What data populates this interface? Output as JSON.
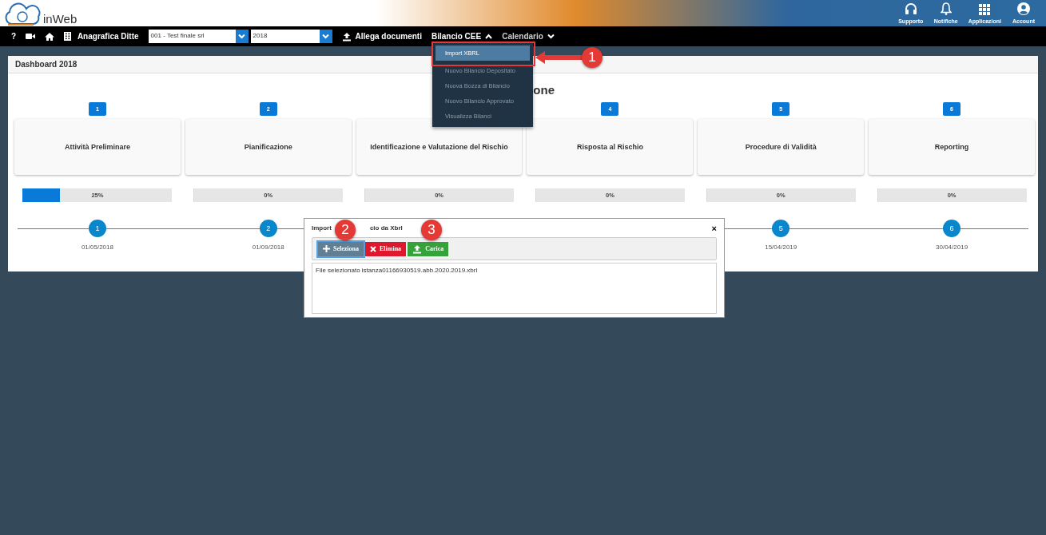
{
  "header": {
    "logo_text": "inWeb",
    "actions": [
      {
        "kind": "headset",
        "label": "Supporto"
      },
      {
        "kind": "bell",
        "label": "Notifiche"
      },
      {
        "kind": "grid",
        "label": "Applicazioni"
      },
      {
        "kind": "user",
        "label": "Account"
      }
    ]
  },
  "navbar": {
    "help": "?",
    "company_label": "Anagrafica Ditte",
    "company_select": "001 - Test finale srl",
    "year_select": "2018",
    "attach": "Allega documenti",
    "menus": [
      {
        "label": "Bilancio CEE",
        "expanded": true
      },
      {
        "label": "Calendario",
        "expanded": false
      }
    ]
  },
  "dropdown": {
    "items": [
      {
        "label": "Import XBRL",
        "selected": true
      },
      {
        "label": "Nuovo Bilancio Depositato",
        "selected": false
      },
      {
        "label": "Nuova Bozza di Bilancio",
        "selected": false
      },
      {
        "label": "Nuovo Bilancio Approvato",
        "selected": false
      },
      {
        "label": "Visualizza Bilanci",
        "selected": false
      }
    ]
  },
  "panel": {
    "title": "Dashboard 2018",
    "heading_fragment": "one",
    "stages": [
      {
        "badge": "1",
        "name": "Attività Preliminare",
        "level": 0.25,
        "percent": "25%",
        "milestone": {
          "number": "1",
          "date": "01/05/2018"
        }
      },
      {
        "badge": "2",
        "name": "Pianificazione",
        "level": 0,
        "percent": "0%",
        "milestone": {
          "number": "2",
          "date": "01/09/2018"
        }
      },
      {
        "name": "Identificazione e Valutazione del Rischio",
        "level": 0,
        "percent": "0%"
      },
      {
        "badge": "4",
        "name": "Risposta al Rischio",
        "level": 0,
        "percent": "0%"
      },
      {
        "badge": "5",
        "name": "Procedure di Validità",
        "level": 0,
        "percent": "0%",
        "milestone": {
          "number": "5",
          "date": "15/04/2019"
        }
      },
      {
        "badge": "6",
        "name": "Reporting",
        "level": 0,
        "percent": "0%",
        "milestone": {
          "number": "6",
          "date": "30/04/2019"
        }
      }
    ]
  },
  "dialog": {
    "title_start": "Import",
    "title_end": "cio da Xbrl",
    "close": "×",
    "buttons": [
      {
        "kind": "select",
        "label": "Seleziona"
      },
      {
        "kind": "delete",
        "label": "Elimina"
      },
      {
        "kind": "upload",
        "label": "Carica"
      }
    ],
    "message": "File selezionato istanza01166930519.abb.2020.2019.xbrl"
  },
  "callouts": [
    "1",
    "2",
    "3"
  ]
}
